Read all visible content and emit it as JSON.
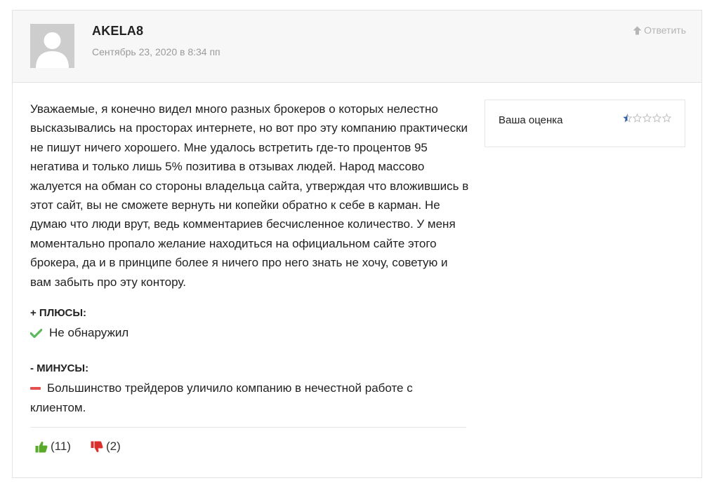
{
  "comment": {
    "author": "AKELA8",
    "date": "Сентябрь 23, 2020 в 8:34 пп",
    "reply_label": "Ответить",
    "text": "Уважаемые, я конечно видел много разных брокеров о которых нелестно высказывались на просторах интернете, но вот про эту компанию практически не пишут ничего хорошего. Мне удалось встретить где-то процентов 95 негатива и только лишь 5% позитива в отзывах людей. Народ массово жалуется на обман со стороны владельца сайта, утверждая что вложившись в этот сайт, вы не сможете вернуть ни копейки обратно к себе в карман. Не думаю что люди врут, ведь комментариев бесчисленное количество. У меня моментально пропало желание находиться на официальном сайте этого брокера, да и в принципе более я ничего про него знать не хочу, советую и вам забыть про эту контору.",
    "pros_title": "+ ПЛЮСЫ:",
    "pros": [
      "Не обнаружил"
    ],
    "cons_title": "- МИНУСЫ:",
    "cons": [
      "Большинство трейдеров уличило компанию в нечестной работе с клиентом."
    ],
    "likes": "(11)",
    "dislikes": "(2)"
  },
  "rating": {
    "label": "Ваша оценка",
    "value": 0.5,
    "max": 5
  },
  "icons": {
    "reply": "arrow-up-icon",
    "pro": "check-icon",
    "con": "dash-icon",
    "like": "thumbs-up-icon",
    "dislike": "thumbs-down-icon",
    "star": "star-icon"
  },
  "colors": {
    "header_bg": "#f7f7f7",
    "check": "#5cb85c",
    "dash": "#e45050",
    "like": "#59a92b",
    "dislike": "#d9302c",
    "star_fill": "#2f5fa8"
  }
}
